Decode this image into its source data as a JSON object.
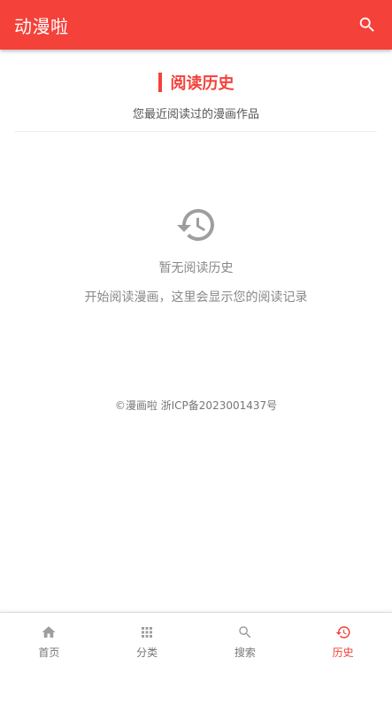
{
  "app": {
    "title": "动漫啦"
  },
  "colors": {
    "accent": "#f4413a",
    "text_muted": "#888888",
    "nav_inactive": "#9e9e9e"
  },
  "header": {
    "search_icon": "search-icon"
  },
  "section": {
    "title": "阅读历史",
    "subtitle": "您最近阅读过的漫画作品"
  },
  "empty_state": {
    "icon": "history-icon",
    "title": "暂无阅读历史",
    "description": "开始阅读漫画，这里会显示您的阅读记录"
  },
  "footer": {
    "copyright": "©漫画啦 浙ICP备2023001437号"
  },
  "bottom_nav": {
    "items": [
      {
        "label": "首页",
        "icon": "home-icon",
        "active": false
      },
      {
        "label": "分类",
        "icon": "grid-icon",
        "active": false
      },
      {
        "label": "搜索",
        "icon": "search-icon",
        "active": false
      },
      {
        "label": "历史",
        "icon": "history-icon",
        "active": true
      }
    ]
  }
}
